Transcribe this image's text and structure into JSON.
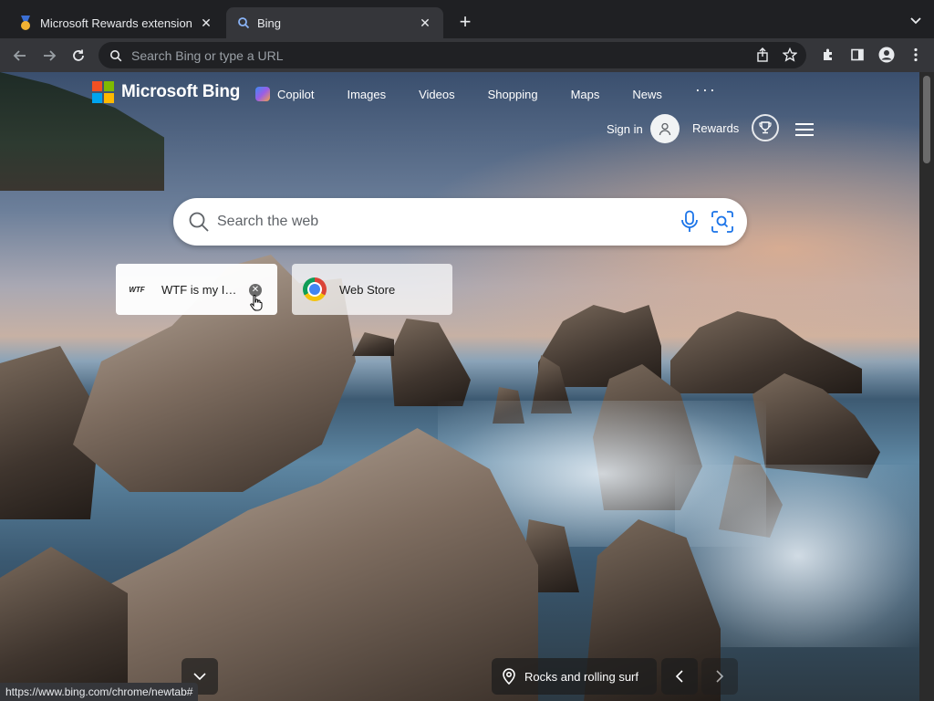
{
  "tabs": [
    {
      "title": "Microsoft Rewards extension",
      "active": false
    },
    {
      "title": "Bing",
      "active": true
    }
  ],
  "omnibox": {
    "placeholder": "Search Bing or type a URL"
  },
  "bing": {
    "brand": "Microsoft Bing",
    "nav": [
      "Copilot",
      "Images",
      "Videos",
      "Shopping",
      "Maps",
      "News"
    ],
    "more": "···",
    "signin_label": "Sign in",
    "rewards_label": "Rewards",
    "search_placeholder": "Search the web"
  },
  "quick_links": [
    {
      "title": "WTF is my I…",
      "logo_text": "WTF"
    },
    {
      "title": "Web Store"
    }
  ],
  "image_caption": "Rocks and rolling surf",
  "status_url": "https://www.bing.com/chrome/newtab#",
  "colors": {
    "ms_red": "#f25022",
    "ms_green": "#7fba00",
    "ms_blue": "#00a4ef",
    "ms_yellow": "#ffb900",
    "bing_icon_blue": "#1a73e8"
  }
}
